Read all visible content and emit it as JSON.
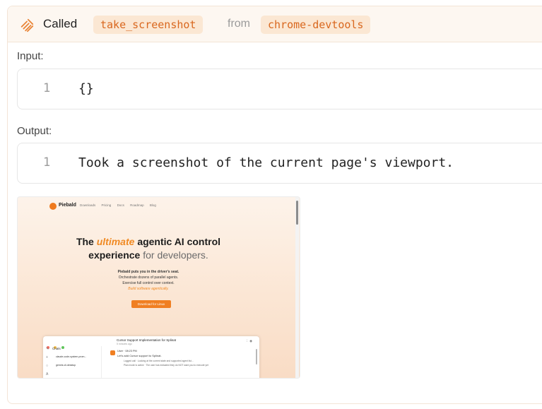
{
  "header": {
    "icon": "tool-call-icon",
    "called_label": "Called",
    "tool_name": "take_screenshot",
    "from_label": "from",
    "server_name": "chrome-devtools",
    "accent": "#d9671e"
  },
  "input": {
    "label": "Input:",
    "line_number": "1",
    "code": "{}"
  },
  "output": {
    "label": "Output:",
    "line_number": "1",
    "code": "Took a screenshot of the current page's viewport."
  },
  "screenshot": {
    "brand": "Piebald",
    "nav_links": [
      "Downloads",
      "Pricing",
      "Docs",
      "Roadmap",
      "Blog"
    ],
    "hero": {
      "the": "The",
      "ultimate": "ultimate",
      "line1_rest": "agentic AI control",
      "experience": "experience",
      "line2_rest": "for developers."
    },
    "sub": {
      "line1": "Piebald puts you in the driver's seat.",
      "line2": "Orchestrate dozens of parallel agents.",
      "line3": "Exercise full control over context.",
      "line4": "Build software agentically."
    },
    "button": "Download for Linux",
    "app": {
      "title": "Cursor Support Implementation for Splinat",
      "subtitle": "5 minutes ago",
      "chats_label": "Chats",
      "items": [
        {
          "title": "claude-code-system-prom...",
          "sub": "Orchestrate/research · 1 min"
        },
        {
          "title": "gemini-cli-desktop",
          "sub": "Orchestrate/research · 1 min"
        }
      ],
      "msg_user": "User · 08:23 PM",
      "msg_text": "Let's add Cursor support to Splinat.",
      "msg_line1": "Logged call · Looking at the current state and supported agent list...",
      "msg_line2": "Plan mode is active · The user has indicated they do NOT want you to execute yet"
    }
  }
}
